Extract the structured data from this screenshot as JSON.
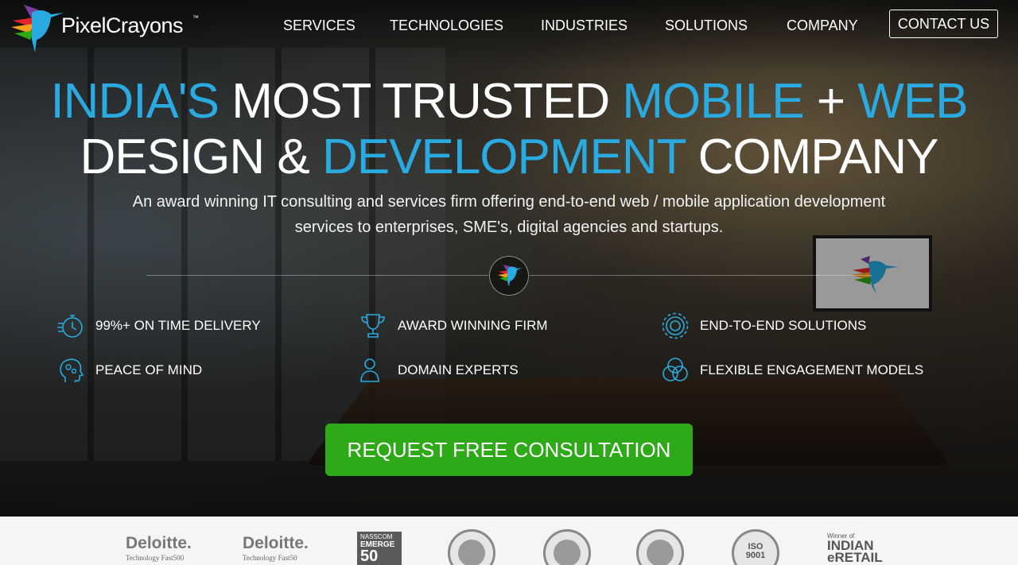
{
  "brand": {
    "name": "PixelCrayons",
    "tm": "™"
  },
  "nav": {
    "items": [
      "SERVICES",
      "TECHNOLOGIES",
      "INDUSTRIES",
      "SOLUTIONS",
      "COMPANY"
    ],
    "contact": "CONTACT US"
  },
  "hero": {
    "line1": {
      "part1": "INDIA'S",
      "part2": "MOST TRUSTED",
      "part3": "MOBILE",
      "part4": "+",
      "part5": "WEB"
    },
    "line2": {
      "part1": "DESIGN &",
      "part2": "DEVELOPMENT",
      "part3": "COMPANY"
    },
    "subtitle": "An award winning IT consulting and services firm offering end-to-end web / mobile application development services to enterprises, SME's, digital agencies and startups."
  },
  "features": [
    {
      "label": "99%+ ON TIME DELIVERY",
      "icon": "stopwatch-icon"
    },
    {
      "label": "AWARD WINNING FIRM",
      "icon": "trophy-icon"
    },
    {
      "label": "END-TO-END SOLUTIONS",
      "icon": "gear-icon"
    },
    {
      "label": "PEACE OF MIND",
      "icon": "head-gears-icon"
    },
    {
      "label": "DOMAIN EXPERTS",
      "icon": "user-icon"
    },
    {
      "label": "FLEXIBLE ENGAGEMENT MODELS",
      "icon": "venn-circles-icon"
    }
  ],
  "cta": {
    "label": "REQUEST FREE CONSULTATION"
  },
  "awards": {
    "deloitte1": {
      "name": "Deloitte.",
      "sub": "Technology Fast500"
    },
    "deloitte2": {
      "name": "Deloitte.",
      "sub": "Technology Fast50"
    },
    "nasscom": {
      "top": "NASSCOM",
      "mid": "EMERGE",
      "num": "50"
    },
    "iso": {
      "line1": "ISO",
      "line2": "9001"
    },
    "indian": {
      "winner": "Winner of",
      "line1": "INDIAN",
      "line2": "eRETAIL"
    }
  },
  "colors": {
    "accent": "#29abe2",
    "cta": "#2eaa19"
  }
}
